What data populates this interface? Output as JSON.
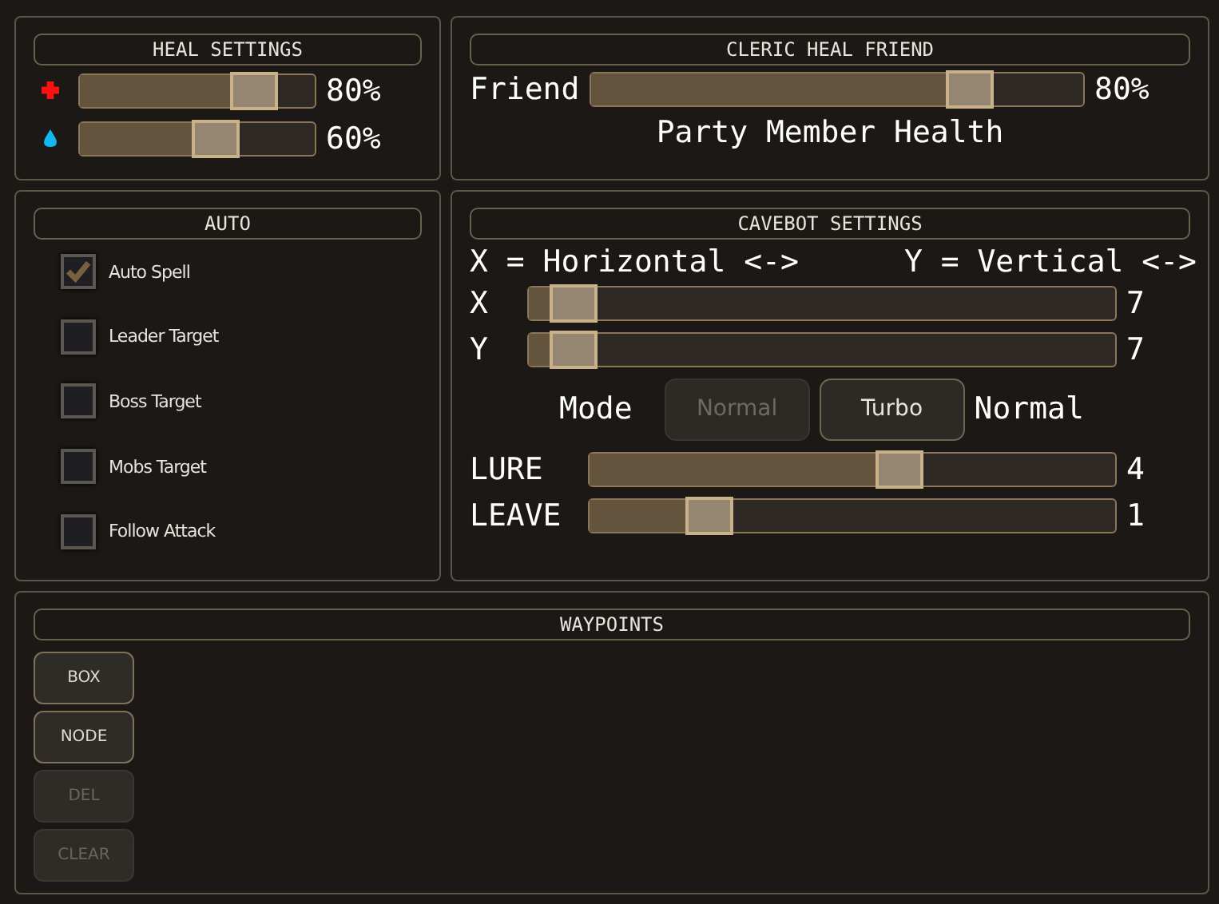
{
  "heal_settings": {
    "title": "HEAL SETTINGS",
    "sliders": [
      {
        "kind": "health",
        "level": 0.8,
        "reading": "80%"
      },
      {
        "kind": "mana",
        "level": 0.6,
        "reading": "60%"
      }
    ]
  },
  "cleric_heal_friend": {
    "title": "CLERIC HEAL FRIEND",
    "slider": {
      "label": "Friend",
      "level": 0.8,
      "reading": "80%"
    },
    "caption": "Party Member Health"
  },
  "auto": {
    "title": "AUTO",
    "options": [
      {
        "label": "Auto Spell",
        "checked": true
      },
      {
        "label": "Leader Target",
        "checked": false
      },
      {
        "label": "Boss Target",
        "checked": false
      },
      {
        "label": "Mobs Target",
        "checked": false
      },
      {
        "label": "Follow Attack",
        "checked": false
      }
    ]
  },
  "cavebot_settings": {
    "title": "CAVEBOT SETTINGS",
    "legend": [
      "X = Horizontal <->",
      "Y = Vertical <->"
    ],
    "axis_sliders": [
      {
        "label": "X",
        "level": 0.04,
        "reading": "7"
      },
      {
        "label": "Y",
        "level": 0.04,
        "reading": "7"
      }
    ],
    "mode": {
      "label": "Mode",
      "buttons": [
        {
          "label": "Normal",
          "disabled": true
        },
        {
          "label": "Turbo",
          "disabled": false
        }
      ],
      "value": "Normal"
    },
    "sliders": [
      {
        "label": "LURE",
        "level": 0.6,
        "reading": "4"
      },
      {
        "label": "LEAVE",
        "level": 0.2,
        "reading": "1"
      }
    ]
  },
  "waypoints": {
    "title": "WAYPOINTS",
    "buttons": [
      {
        "label": "BOX",
        "disabled": false
      },
      {
        "label": "NODE",
        "disabled": false
      },
      {
        "label": "DEL",
        "disabled": true
      },
      {
        "label": "CLEAR",
        "disabled": true
      }
    ]
  }
}
